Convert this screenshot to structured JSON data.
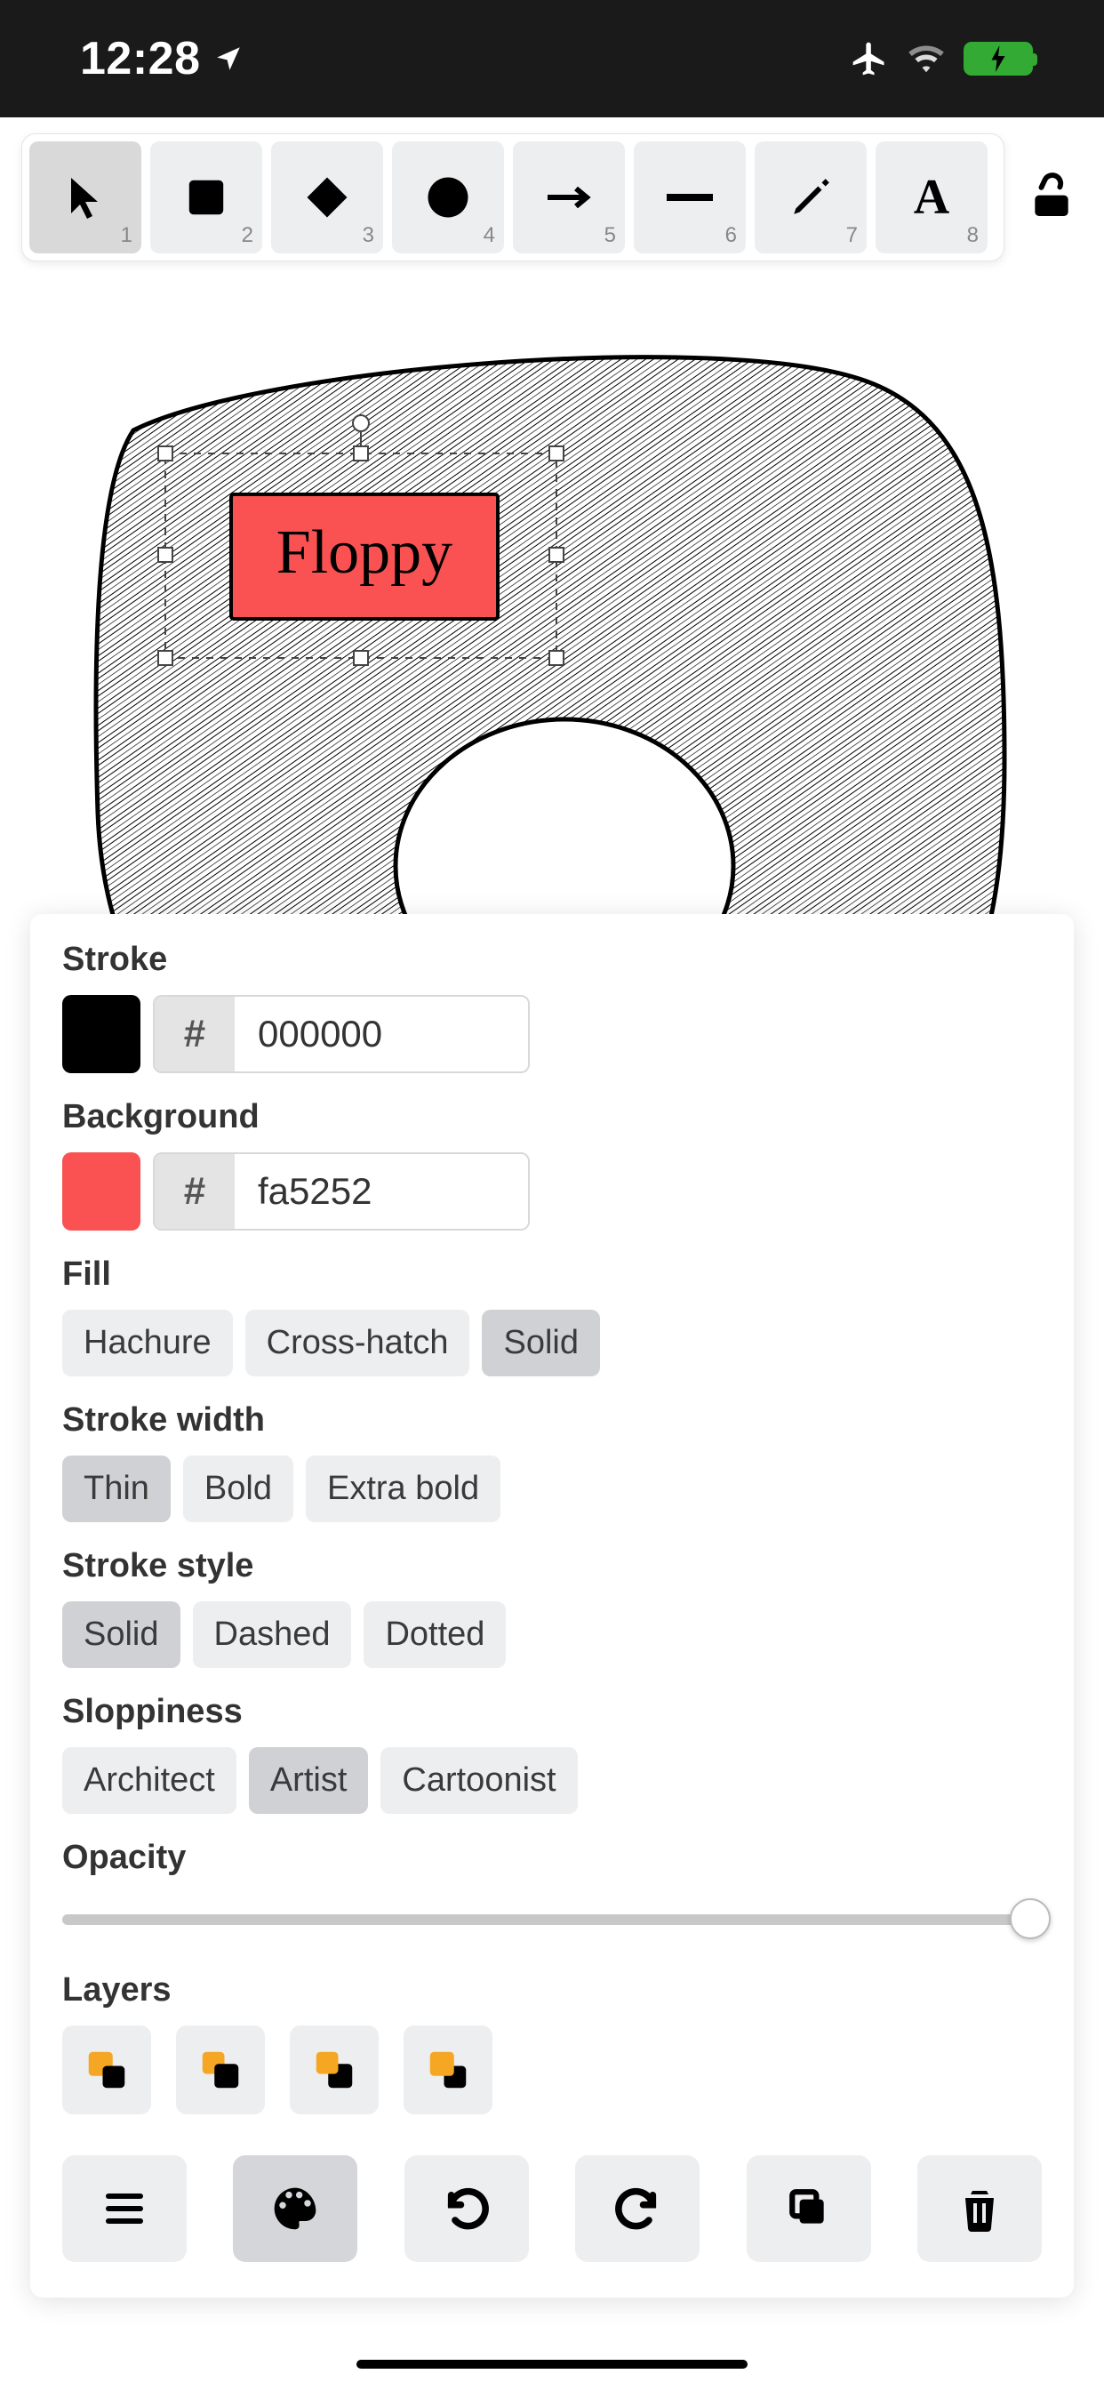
{
  "status": {
    "time": "12:28",
    "airplane_mode": true,
    "wifi": true,
    "battery_charging": true
  },
  "toolbar": {
    "tools": [
      {
        "name": "selection",
        "num": "1",
        "selected": true
      },
      {
        "name": "rectangle",
        "num": "2",
        "selected": false
      },
      {
        "name": "diamond",
        "num": "3",
        "selected": false
      },
      {
        "name": "ellipse",
        "num": "4",
        "selected": false
      },
      {
        "name": "arrow",
        "num": "5",
        "selected": false
      },
      {
        "name": "line",
        "num": "6",
        "selected": false
      },
      {
        "name": "draw",
        "num": "7",
        "selected": false
      },
      {
        "name": "text",
        "num": "8",
        "selected": false
      }
    ],
    "locked": false
  },
  "canvas": {
    "element_text": "Floppy",
    "element_fill": "#fa5252"
  },
  "props": {
    "stroke_label": "Stroke",
    "stroke_hex": "000000",
    "stroke_swatch": "#000000",
    "background_label": "Background",
    "background_hex": "fa5252",
    "background_swatch": "#fa5252",
    "fill_label": "Fill",
    "fill_options": [
      {
        "label": "Hachure",
        "selected": false
      },
      {
        "label": "Cross-hatch",
        "selected": false
      },
      {
        "label": "Solid",
        "selected": true
      }
    ],
    "stroke_width_label": "Stroke width",
    "stroke_width_options": [
      {
        "label": "Thin",
        "selected": true
      },
      {
        "label": "Bold",
        "selected": false
      },
      {
        "label": "Extra bold",
        "selected": false
      }
    ],
    "stroke_style_label": "Stroke style",
    "stroke_style_options": [
      {
        "label": "Solid",
        "selected": true
      },
      {
        "label": "Dashed",
        "selected": false
      },
      {
        "label": "Dotted",
        "selected": false
      }
    ],
    "sloppiness_label": "Sloppiness",
    "sloppiness_options": [
      {
        "label": "Architect",
        "selected": false
      },
      {
        "label": "Artist",
        "selected": true
      },
      {
        "label": "Cartoonist",
        "selected": false
      }
    ],
    "opacity_label": "Opacity",
    "opacity_value": 100,
    "layers_label": "Layers",
    "layer_actions": [
      "send-to-back",
      "send-backward",
      "bring-forward",
      "bring-to-front"
    ],
    "bottom_actions": [
      "menu",
      "palette",
      "undo",
      "redo",
      "duplicate",
      "delete"
    ]
  }
}
